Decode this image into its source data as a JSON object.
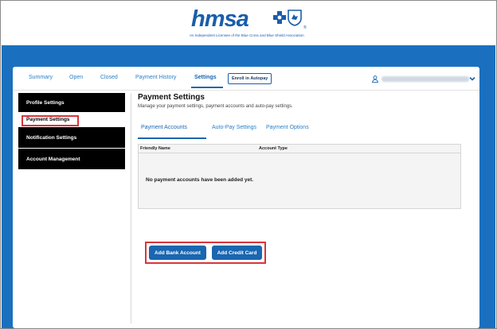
{
  "brand": {
    "wordmark": "hmsa",
    "tagline": "An Independent Licensee of the Blue Cross and Blue Shield Association",
    "registered": "®",
    "blue": "#1a5dab",
    "bar_blue": "#1a70bf"
  },
  "nav": {
    "tabs": [
      {
        "label": "Summary"
      },
      {
        "label": "Open"
      },
      {
        "label": "Closed"
      },
      {
        "label": "Payment History"
      },
      {
        "label": "Settings",
        "active": true
      }
    ],
    "autopay_button": "Enroll in Autopay",
    "user_icon": "user-icon",
    "chevron_icon": "chevron-down-icon"
  },
  "sidebar": {
    "items": [
      {
        "label": "Profile Settings"
      },
      {
        "label": "Payment Settings",
        "selected": true
      },
      {
        "label": "Notification Settings"
      },
      {
        "label": "Account Management"
      }
    ]
  },
  "main": {
    "title": "Payment Settings",
    "subtitle": "Manage your payment settings, payment accounts and auto-pay settings.",
    "subtabs": [
      {
        "label": "Payment Accounts",
        "active": true
      },
      {
        "label": "Auto-Pay Settings"
      },
      {
        "label": "Payment Options"
      }
    ],
    "table": {
      "columns": [
        "Friendly Name",
        "Account Type"
      ],
      "empty_message": "No payment accounts have been added yet."
    },
    "buttons": {
      "add_bank": "Add Bank Account",
      "add_card": "Add Credit Card"
    },
    "highlight_color": "#d9343a"
  }
}
